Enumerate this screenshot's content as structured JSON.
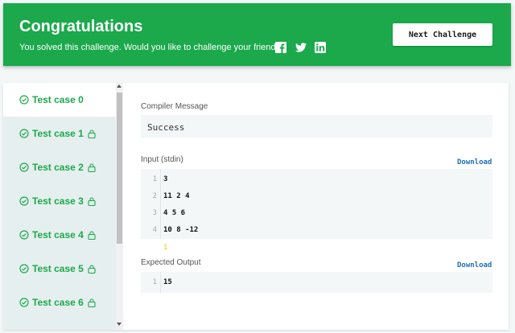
{
  "banner": {
    "title": "Congratulations",
    "subtitle": "You solved this challenge. Would you like to challenge your friends?",
    "share_icons": [
      "facebook-icon",
      "twitter-icon",
      "linkedin-icon"
    ],
    "next_label": "Next Challenge",
    "color": "#1ba94c"
  },
  "tabs": [
    {
      "label": "Test case 0",
      "active": true,
      "locked": false
    },
    {
      "label": "Test case 1",
      "active": false,
      "locked": true
    },
    {
      "label": "Test case 2",
      "active": false,
      "locked": true
    },
    {
      "label": "Test case 3",
      "active": false,
      "locked": true
    },
    {
      "label": "Test case 4",
      "active": false,
      "locked": true
    },
    {
      "label": "Test case 5",
      "active": false,
      "locked": true
    },
    {
      "label": "Test case 6",
      "active": false,
      "locked": true
    }
  ],
  "compiler": {
    "label": "Compiler Message",
    "message": "Success"
  },
  "input": {
    "label": "Input (stdin)",
    "download": "Download",
    "lines": [
      {
        "n": "1",
        "text": "3"
      },
      {
        "n": "2",
        "text": "11 2 4"
      },
      {
        "n": "3",
        "text": "4 5 6"
      },
      {
        "n": "4",
        "text": "10 8 -12"
      }
    ]
  },
  "expected": {
    "label": "Expected Output",
    "download": "Download",
    "lines": [
      {
        "n": "1",
        "text": "15"
      }
    ]
  },
  "cursor_char": "1"
}
